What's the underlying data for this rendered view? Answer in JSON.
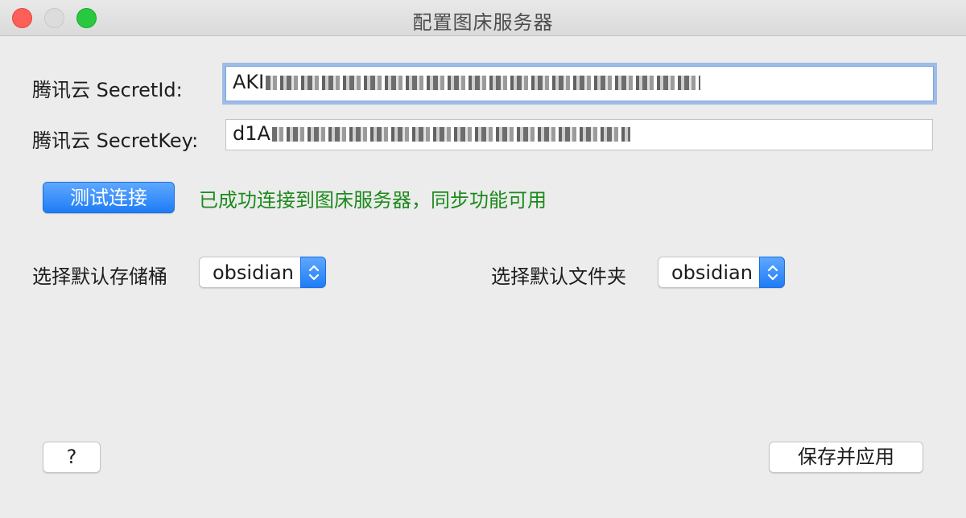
{
  "window": {
    "title": "配置图床服务器"
  },
  "form": {
    "secret_id_label": "腾讯云 SecretId:",
    "secret_id_value_prefix": "AKI",
    "secret_key_label": "腾讯云 SecretKey:",
    "secret_key_value_prefix": "d1A"
  },
  "test": {
    "button_label": "测试连接",
    "status_text": "已成功连接到图床服务器，同步功能可用",
    "status_color": "#1b8a1b"
  },
  "bucket": {
    "label": "选择默认存储桶",
    "selected": "obsidian"
  },
  "folder": {
    "label": "选择默认文件夹",
    "selected": "obsidian"
  },
  "footer": {
    "help_label": "?",
    "save_label": "保存并应用"
  },
  "colors": {
    "accent": "#1f7cf6",
    "close": "#fe5f57",
    "zoom": "#28c840"
  }
}
